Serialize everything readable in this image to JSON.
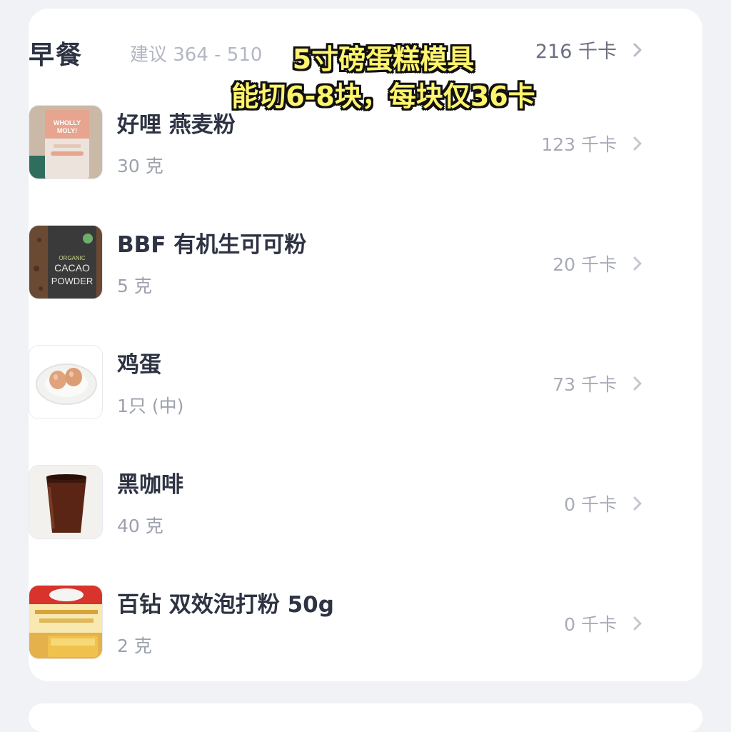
{
  "meal": {
    "title": "早餐",
    "suggestion": "建议 364 - 510",
    "total_kcal": "216 千卡"
  },
  "overlay": {
    "line1": "5寸磅蛋糕模具",
    "line2": "能切6-8块，每块仅36卡"
  },
  "foods": [
    {
      "name": "好哩 燕麦粉",
      "qty": "30 克",
      "kcal": "123 千卡",
      "thumb": "oat-flour-bag"
    },
    {
      "name": "BBF 有机生可可粉",
      "qty": "5 克",
      "kcal": "20 千卡",
      "thumb": "cacao-powder-bag"
    },
    {
      "name": "鸡蛋",
      "qty": "1只 (中)",
      "kcal": "73 千卡",
      "thumb": "eggs-on-plate"
    },
    {
      "name": "黑咖啡",
      "qty": "40 克",
      "kcal": "0 千卡",
      "thumb": "black-coffee-cup"
    },
    {
      "name": "百钻 双效泡打粉 50g",
      "qty": "2 克",
      "kcal": "0 千卡",
      "thumb": "baking-powder-pack"
    }
  ],
  "thumb_labels": {
    "oat": "WHOLLY MOLY!",
    "cacao": "ORGANIC CACAO POWDER"
  }
}
